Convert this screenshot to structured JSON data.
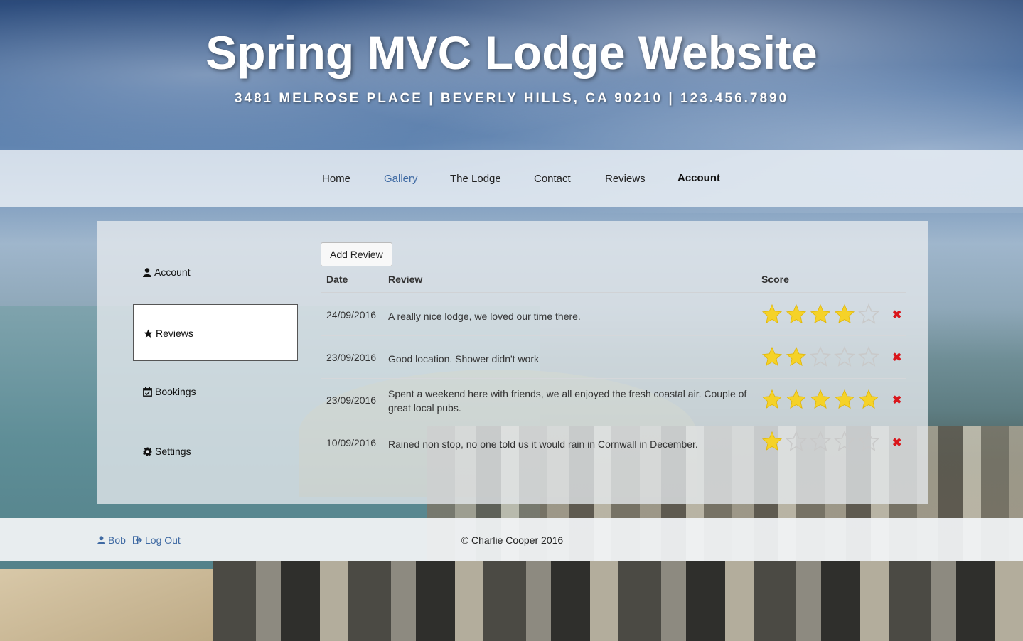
{
  "header": {
    "title": "Spring MVC Lodge Website",
    "address": "3481 MELROSE PLACE | BEVERLY HILLS, CA 90210 | 123.456.7890"
  },
  "nav": {
    "items": [
      "Home",
      "Gallery",
      "The Lodge",
      "Contact",
      "Reviews",
      "Account"
    ],
    "hover": "Gallery",
    "current": "Account"
  },
  "sidebar": {
    "items": [
      {
        "label": "Account",
        "icon": "user-icon"
      },
      {
        "label": "Reviews",
        "icon": "star-icon"
      },
      {
        "label": "Bookings",
        "icon": "calendar-check-icon"
      },
      {
        "label": "Settings",
        "icon": "gear-icon"
      }
    ],
    "selected": "Reviews"
  },
  "reviews": {
    "add_button": "Add Review",
    "columns": [
      "Date",
      "Review",
      "Score"
    ],
    "rows": [
      {
        "date": "24/09/2016",
        "review": "A really nice lodge, we loved our time there.",
        "score": 4
      },
      {
        "date": "23/09/2016",
        "review": "Good location. Shower didn't work",
        "score": 2
      },
      {
        "date": "23/09/2016",
        "review": "Spent a weekend here with friends, we all enjoyed the fresh coastal air. Couple of great local pubs.",
        "score": 5
      },
      {
        "date": "10/09/2016",
        "review": "Rained non stop, no one told us it would rain in Cornwall in December.",
        "score": 1
      }
    ],
    "max_score": 5,
    "delete_icon": "delete-x-icon"
  },
  "footer": {
    "user": "Bob",
    "logout": "Log Out",
    "copyright": "© Charlie Cooper 2016"
  },
  "colors": {
    "link": "#3f6aa3",
    "star_filled": "#f5d228",
    "star_empty": "#c9c9c9",
    "delete": "#d9161b"
  }
}
